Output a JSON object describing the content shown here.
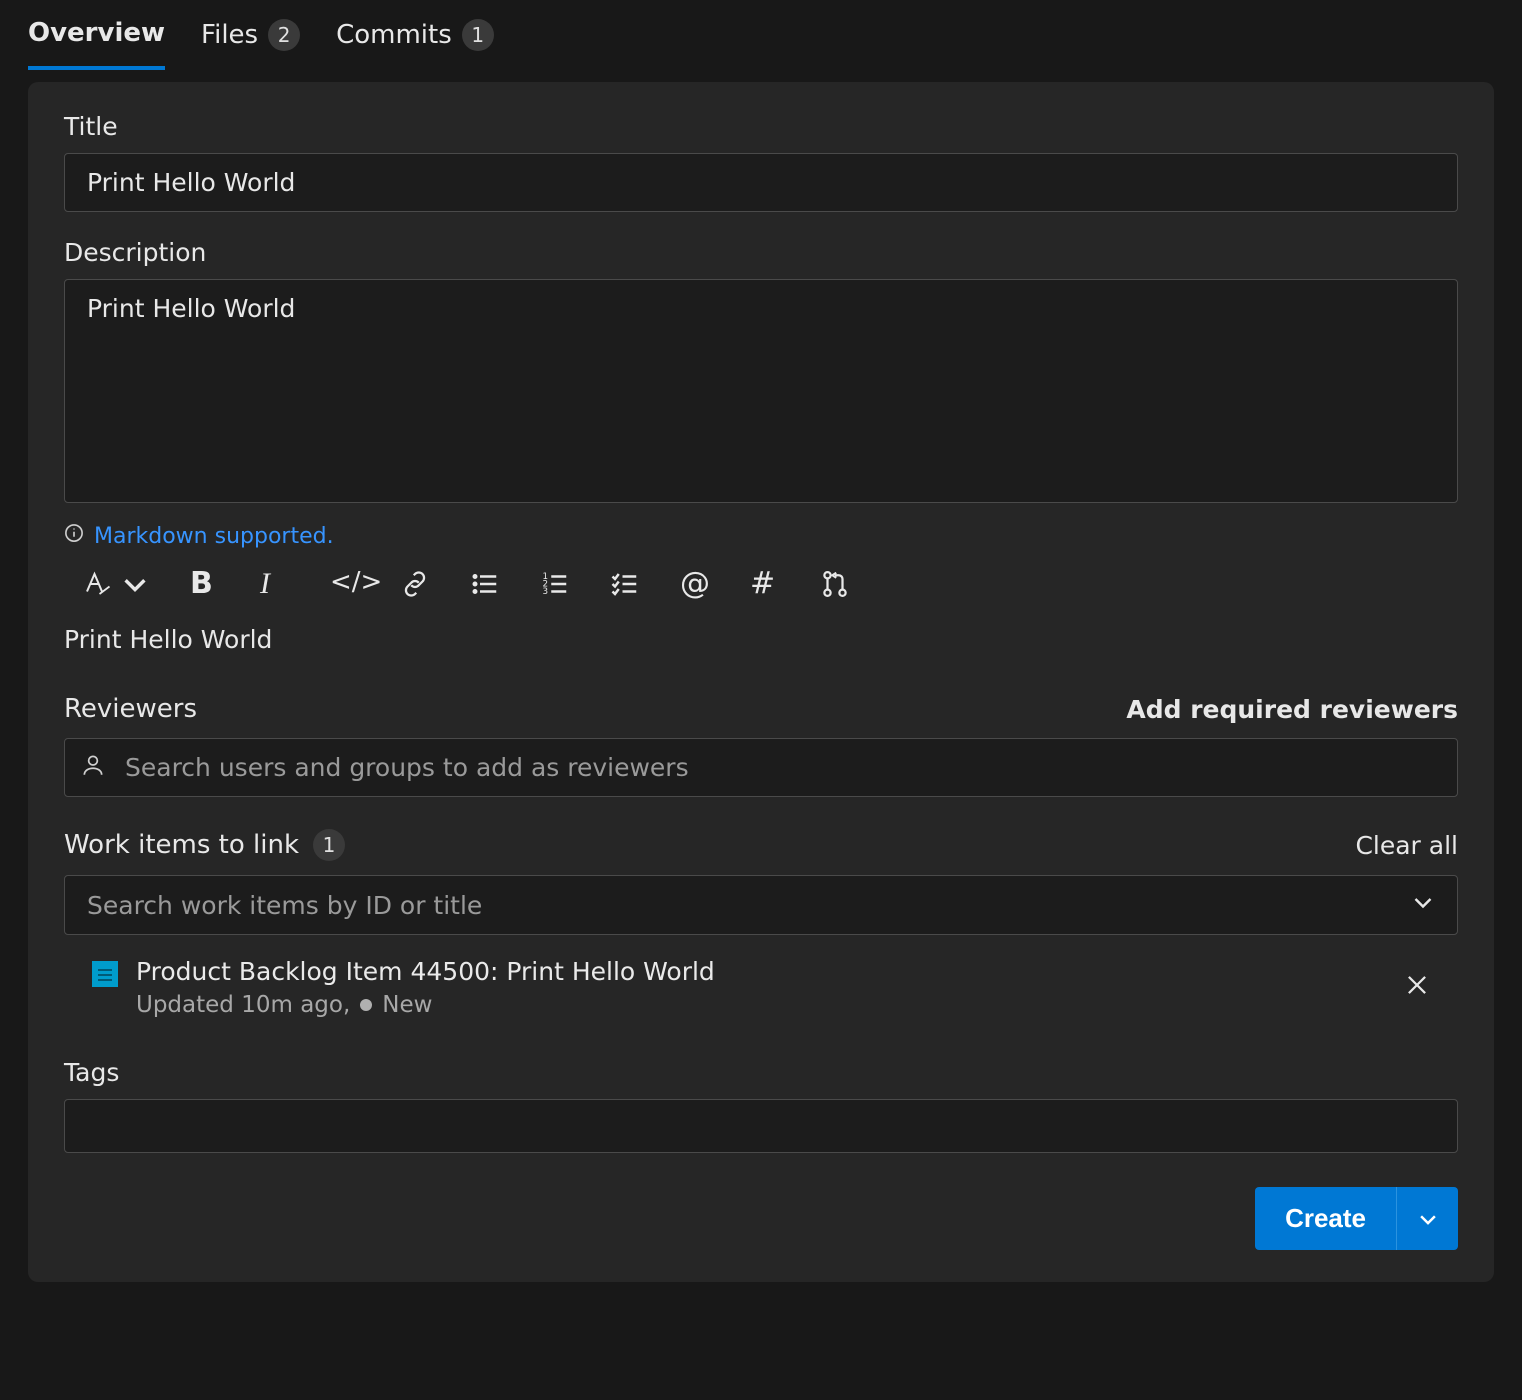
{
  "tabs": [
    {
      "label": "Overview",
      "count": null,
      "active": true
    },
    {
      "label": "Files",
      "count": "2",
      "active": false
    },
    {
      "label": "Commits",
      "count": "1",
      "active": false
    }
  ],
  "title": {
    "label": "Title",
    "value": "Print Hello World"
  },
  "description": {
    "label": "Description",
    "value": "Print Hello World",
    "markdown_hint": "Markdown supported.",
    "preview": "Print Hello World"
  },
  "reviewers": {
    "label": "Reviewers",
    "add_required_label": "Add required reviewers",
    "placeholder": "Search users and groups to add as reviewers"
  },
  "work_items": {
    "label": "Work items to link",
    "count": "1",
    "clear_label": "Clear all",
    "placeholder": "Search work items by ID or title",
    "items": [
      {
        "title": "Product Backlog Item 44500: Print Hello World",
        "updated": "Updated 10m ago,",
        "state": "New"
      }
    ]
  },
  "tags": {
    "label": "Tags"
  },
  "create_label": "Create"
}
